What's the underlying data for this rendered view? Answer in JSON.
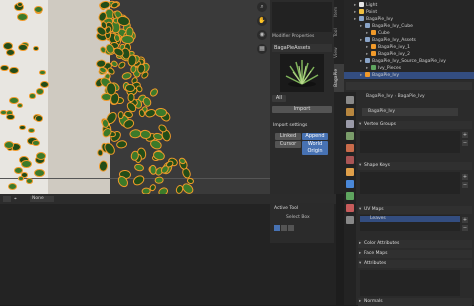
{
  "viewport": {
    "modifier_props_label": "Modifier Properties",
    "snap_mode": "None",
    "gizmo_icons": [
      "search-icon",
      "hand-icon",
      "camera-icon",
      "grid-icon"
    ]
  },
  "npanel": {
    "section_title": "BagaPieAssets",
    "all_label": "All",
    "import_label": "Import",
    "import_settings_title": "Import settings",
    "linked_label": "Linked",
    "append_label": "Append",
    "cursor_label": "Cursor",
    "world_origin_label": "World Origin",
    "tabs": [
      "Item",
      "Tool",
      "View",
      "BagaPie"
    ]
  },
  "active_tool": {
    "title": "Active Tool",
    "select_box_label": "Select Box"
  },
  "outliner": {
    "rows": [
      {
        "indent": 1,
        "name": "Light",
        "sel": false
      },
      {
        "indent": 1,
        "name": "Point",
        "sel": false
      },
      {
        "indent": 1,
        "name": "BagaPie_Ivy",
        "sel": false
      },
      {
        "indent": 2,
        "name": "BagaPie_Ivy_Cube",
        "sel": false
      },
      {
        "indent": 3,
        "name": "Cube",
        "sel": false
      },
      {
        "indent": 2,
        "name": "BagaPie_Ivy_Assets",
        "sel": false
      },
      {
        "indent": 3,
        "name": "BagaPie_ivy_1",
        "sel": false
      },
      {
        "indent": 3,
        "name": "BagaPie_ivy_2",
        "sel": false
      },
      {
        "indent": 2,
        "name": "BagaPie_Ivy_Source_BagaPie_ivy",
        "sel": false
      },
      {
        "indent": 3,
        "name": "Ivy_Pieces",
        "sel": false
      },
      {
        "indent": 2,
        "name": "BagaPie_Ivy",
        "sel": true
      }
    ]
  },
  "properties": {
    "breadcrumb_a": "BagaPie_Ivy",
    "breadcrumb_b": "BagaPie_Ivy",
    "datablock_name": "BagaPie_Ivy",
    "sections": {
      "vertex_groups": "Vertex Groups",
      "shape_keys": "Shape Keys",
      "uv_maps": "UV Maps",
      "color_attributes": "Color Attributes",
      "face_maps": "Face Maps",
      "attributes": "Attributes",
      "normals": "Normals"
    },
    "uv_map_item": "Leaves"
  },
  "colors": {
    "accent": "#4772b3",
    "selection_outline": "#f19a2a",
    "leaf": "#3c7a2a"
  }
}
